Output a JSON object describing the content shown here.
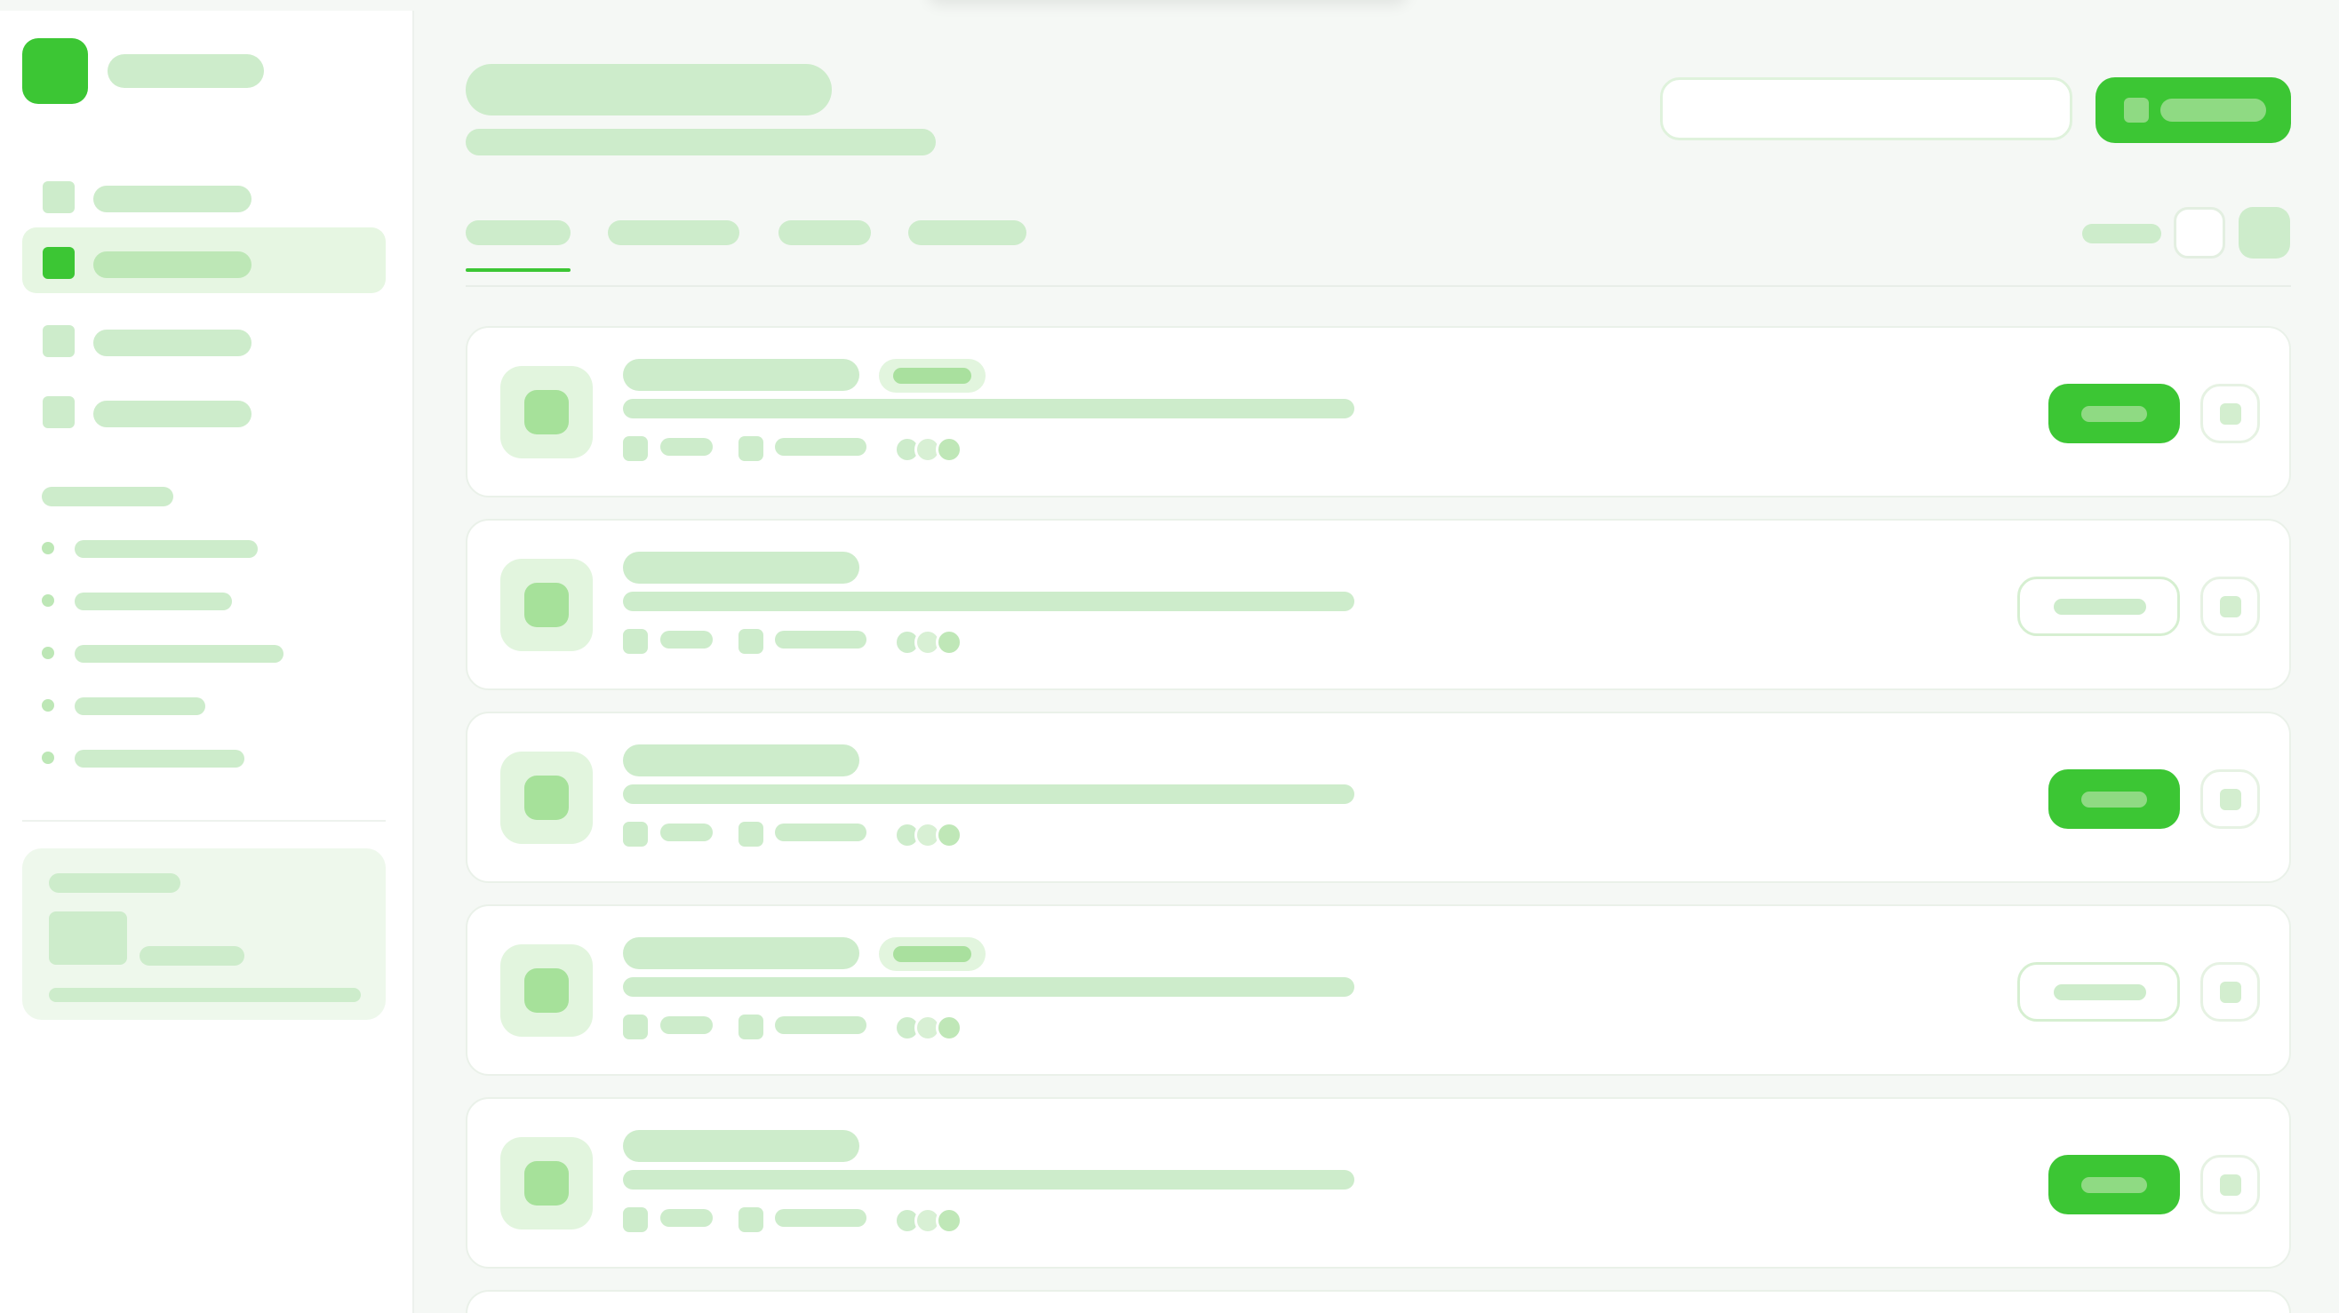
{
  "app": {
    "colors": {
      "accent": "#3cc634",
      "skeleton": "#cdeccb",
      "skeleton_dark": "#a9e09e",
      "active_bg": "#e6f6e2",
      "page_bg": "#f5f8f5"
    }
  },
  "sidebar": {
    "logo_icon": "app-logo-icon",
    "nav_items": [
      {
        "icon": "nav-icon",
        "active": false
      },
      {
        "icon": "nav-icon",
        "active": true
      },
      {
        "icon": "nav-icon",
        "active": false
      },
      {
        "icon": "nav-icon",
        "active": false
      }
    ],
    "section_links_count": 5
  },
  "header": {
    "search": {
      "placeholder": "",
      "value": ""
    },
    "new_button_icon": "plus-icon"
  },
  "tabs": {
    "count": 4,
    "active_index": 0
  },
  "list": {
    "items": [
      {
        "has_badge": true,
        "action": "primary"
      },
      {
        "has_badge": false,
        "action": "secondary"
      },
      {
        "has_badge": false,
        "action": "primary"
      },
      {
        "has_badge": true,
        "action": "secondary"
      },
      {
        "has_badge": false,
        "action": "primary"
      }
    ]
  }
}
